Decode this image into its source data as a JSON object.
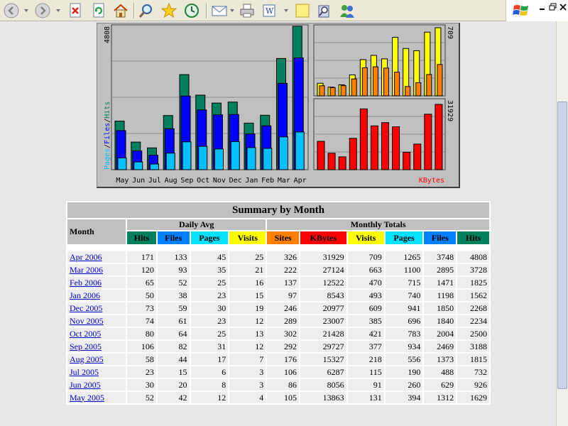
{
  "browser": {
    "toolbar_icons": [
      "back-icon",
      "forward-icon",
      "stop-icon",
      "refresh-icon",
      "home-icon",
      "search-icon",
      "favorites-icon",
      "history-icon",
      "mail-icon",
      "print-icon",
      "edit-icon",
      "note-icon",
      "research-icon",
      "messenger-icon"
    ]
  },
  "chart_data": [
    {
      "type": "bar",
      "title": "",
      "categories": [
        "May",
        "Jun",
        "Jul",
        "Aug",
        "Sep",
        "Oct",
        "Nov",
        "Dec",
        "Jan",
        "Feb",
        "Mar",
        "Apr"
      ],
      "series": [
        {
          "name": "Hits",
          "values": [
            1629,
            926,
            732,
            1815,
            3188,
            2500,
            2234,
            2268,
            1562,
            1825,
            3728,
            4808
          ]
        },
        {
          "name": "Files",
          "values": [
            1312,
            629,
            488,
            1373,
            2469,
            2004,
            1840,
            1850,
            1198,
            1471,
            2895,
            3748
          ]
        },
        {
          "name": "Pages",
          "values": [
            394,
            260,
            190,
            556,
            934,
            783,
            696,
            941,
            740,
            715,
            1100,
            1265
          ]
        }
      ],
      "ylim": [
        0,
        4808
      ],
      "max_label": "4808",
      "legend": [
        "Pages",
        "Files",
        "Hits"
      ],
      "legend_sep": "/",
      "colors": {
        "Hits": "#00805c",
        "Files": "#0000ff",
        "Pages": "#00c0ff"
      }
    },
    {
      "type": "bar",
      "title": "",
      "categories": [
        "May",
        "Jun",
        "Jul",
        "Aug",
        "Sep",
        "Oct",
        "Nov",
        "Dec",
        "Jan",
        "Feb",
        "Mar",
        "Apr"
      ],
      "series": [
        {
          "name": "Visits",
          "values": [
            131,
            91,
            115,
            218,
            377,
            421,
            385,
            609,
            493,
            470,
            663,
            709
          ]
        },
        {
          "name": "Sites",
          "values": [
            105,
            86,
            106,
            176,
            292,
            302,
            289,
            246,
            97,
            137,
            222,
            326
          ]
        }
      ],
      "ylim": [
        0,
        709
      ],
      "max_label": "709",
      "colors": {
        "Visits": "#ffff00",
        "Sites": "#ff8000"
      }
    },
    {
      "type": "bar",
      "title": "",
      "categories": [
        "May",
        "Jun",
        "Jul",
        "Aug",
        "Sep",
        "Oct",
        "Nov",
        "Dec",
        "Jan",
        "Feb",
        "Mar",
        "Apr"
      ],
      "series": [
        {
          "name": "KBytes",
          "values": [
            13863,
            8056,
            6287,
            15327,
            29727,
            21428,
            23007,
            20977,
            8543,
            12522,
            27124,
            31929
          ]
        }
      ],
      "ylim": [
        0,
        31929
      ],
      "max_label": "31929",
      "label": "KBytes",
      "colors": {
        "KBytes": "#ff0000"
      }
    }
  ],
  "summary": {
    "title": "Summary by Month",
    "month_header": "Month",
    "daily_avg_header": "Daily Avg",
    "monthly_totals_header": "Monthly Totals",
    "daily_cols": [
      {
        "label": "Hits",
        "bg": "#00805c",
        "fg": "#000000"
      },
      {
        "label": "Files",
        "bg": "#0080ff",
        "fg": "#000000"
      },
      {
        "label": "Pages",
        "bg": "#00e0ff",
        "fg": "#000000"
      },
      {
        "label": "Visits",
        "bg": "#ffff00",
        "fg": "#000000"
      }
    ],
    "total_cols": [
      {
        "label": "Sites",
        "bg": "#ff8000",
        "fg": "#000000"
      },
      {
        "label": "KBytes",
        "bg": "#ff0000",
        "fg": "#000000"
      },
      {
        "label": "Visits",
        "bg": "#ffff00",
        "fg": "#000000"
      },
      {
        "label": "Pages",
        "bg": "#00e0ff",
        "fg": "#000000"
      },
      {
        "label": "Files",
        "bg": "#0080ff",
        "fg": "#000000"
      },
      {
        "label": "Hits",
        "bg": "#00805c",
        "fg": "#000000"
      }
    ],
    "rows": [
      {
        "month": "Apr 2006",
        "v": [
          "171",
          "133",
          "45",
          "25",
          "326",
          "31929",
          "709",
          "1265",
          "3748",
          "4808"
        ]
      },
      {
        "month": "Mar 2006",
        "v": [
          "120",
          "93",
          "35",
          "21",
          "222",
          "27124",
          "663",
          "1100",
          "2895",
          "3728"
        ]
      },
      {
        "month": "Feb 2006",
        "v": [
          "65",
          "52",
          "25",
          "16",
          "137",
          "12522",
          "470",
          "715",
          "1471",
          "1825"
        ]
      },
      {
        "month": "Jan 2006",
        "v": [
          "50",
          "38",
          "23",
          "15",
          "97",
          "8543",
          "493",
          "740",
          "1198",
          "1562"
        ]
      },
      {
        "month": "Dec 2005",
        "v": [
          "73",
          "59",
          "30",
          "19",
          "246",
          "20977",
          "609",
          "941",
          "1850",
          "2268"
        ]
      },
      {
        "month": "Nov 2005",
        "v": [
          "74",
          "61",
          "23",
          "12",
          "289",
          "23007",
          "385",
          "696",
          "1840",
          "2234"
        ]
      },
      {
        "month": "Oct 2005",
        "v": [
          "80",
          "64",
          "25",
          "13",
          "302",
          "21428",
          "421",
          "783",
          "2004",
          "2500"
        ]
      },
      {
        "month": "Sep 2005",
        "v": [
          "106",
          "82",
          "31",
          "12",
          "292",
          "29727",
          "377",
          "934",
          "2469",
          "3188"
        ]
      },
      {
        "month": "Aug 2005",
        "v": [
          "58",
          "44",
          "17",
          "7",
          "176",
          "15327",
          "218",
          "556",
          "1373",
          "1815"
        ]
      },
      {
        "month": "Jul 2005",
        "v": [
          "23",
          "15",
          "6",
          "3",
          "106",
          "6287",
          "115",
          "190",
          "488",
          "732"
        ]
      },
      {
        "month": "Jun 2005",
        "v": [
          "30",
          "20",
          "8",
          "3",
          "86",
          "8056",
          "91",
          "260",
          "629",
          "926"
        ]
      },
      {
        "month": "May 2005",
        "v": [
          "52",
          "42",
          "12",
          "4",
          "105",
          "13863",
          "131",
          "394",
          "1312",
          "1629"
        ]
      }
    ]
  }
}
